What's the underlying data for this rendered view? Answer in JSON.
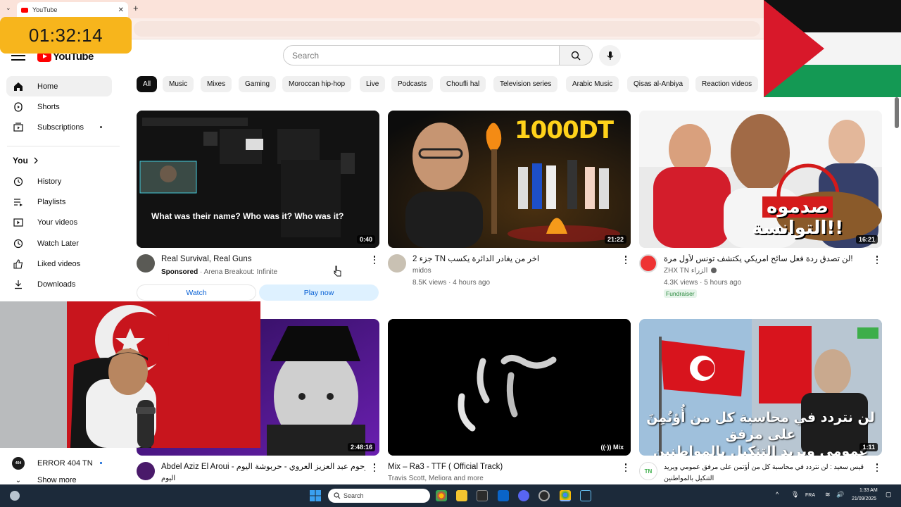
{
  "browser": {
    "tab_title": "YouTube",
    "tab_close": "✕",
    "new_tab": "+"
  },
  "overlay": {
    "timer": "01:32:14"
  },
  "header": {
    "logo_text": "YouTube",
    "search_placeholder": "Search"
  },
  "sidebar": {
    "main": [
      {
        "label": "Home",
        "icon": "home-icon"
      },
      {
        "label": "Shorts",
        "icon": "shorts-icon"
      },
      {
        "label": "Subscriptions",
        "icon": "subscriptions-icon"
      }
    ],
    "you_label": "You",
    "you_items": [
      {
        "label": "History",
        "icon": "history-icon"
      },
      {
        "label": "Playlists",
        "icon": "playlists-icon"
      },
      {
        "label": "Your videos",
        "icon": "your-videos-icon"
      },
      {
        "label": "Watch Later",
        "icon": "watch-later-icon"
      },
      {
        "label": "Liked videos",
        "icon": "liked-videos-icon"
      },
      {
        "label": "Downloads",
        "icon": "downloads-icon"
      }
    ],
    "subscription": {
      "label": "ERROR 404 TN",
      "avatar_text": "404"
    },
    "show_more": "Show more"
  },
  "chips": [
    "All",
    "Music",
    "Mixes",
    "Gaming",
    "Moroccan hip-hop",
    "Live",
    "Podcasts",
    "Choufli hal",
    "Television series",
    "Arabic Music",
    "Qisas al-Anbiya",
    "Reaction videos"
  ],
  "videos": [
    {
      "title": "Real Survival, Real Guns",
      "thumb_caption": "What was their name? Who was it? Who was it?",
      "sponsored": "Sponsored",
      "sponsor_line": " · Arena Breakout: Infinite",
      "duration": "0:40",
      "watch_label": "Watch",
      "play_label": "Play now"
    },
    {
      "title": "جزء 2 TN اخر من يغادر الدائرة يكسب",
      "thumb_text": "1000DT",
      "channel": "midos",
      "meta": "8.5K views · 4 hours ago",
      "duration": "21:22"
    },
    {
      "title": "لن تصدق ردة فعل سائح امريكي يكتشف تونس لأول مرة!",
      "thumb_text_1": "صدموه",
      "thumb_text_2": "التوانسة!!",
      "channel": "ZHX TN الزراء",
      "meta": "4.3K views · 5 hours ago",
      "badge": "Fundraiser",
      "duration": "16:21"
    },
    {
      "title": "Abdel Aziz El Aroui - حكايات المرحوم عبد العزيز العروي - حربوشة اليوم",
      "title_line2": "اليوم",
      "duration": "2:48:16"
    },
    {
      "title": "Mix – Ra3 - TTF ( Official Track)",
      "channel": "Travis Scott, Meliora and more",
      "duration": "Mix"
    },
    {
      "title": "قيس سعيد : لن نتردد في محاسبة كل من أؤتمن على مرفق عمومي ويريد",
      "title_line2": "التنكيل بالمواطنين",
      "thumb_text_1": "لن نتردد في محاسبة كل من أُؤتُمِنَ على مرفق",
      "thumb_text_2": "عمومي ويريد التنكيل بالمواطنين",
      "duration": "1:11",
      "channel_badge": "TN"
    }
  ],
  "taskbar": {
    "search_label": "Search",
    "lang": "FRA",
    "time": "1:33 AM",
    "date": "21/09/2025"
  },
  "colors": {
    "accent": "#ff0000",
    "timer": "#f7b51c",
    "taskbar": "#1c2a3a"
  }
}
